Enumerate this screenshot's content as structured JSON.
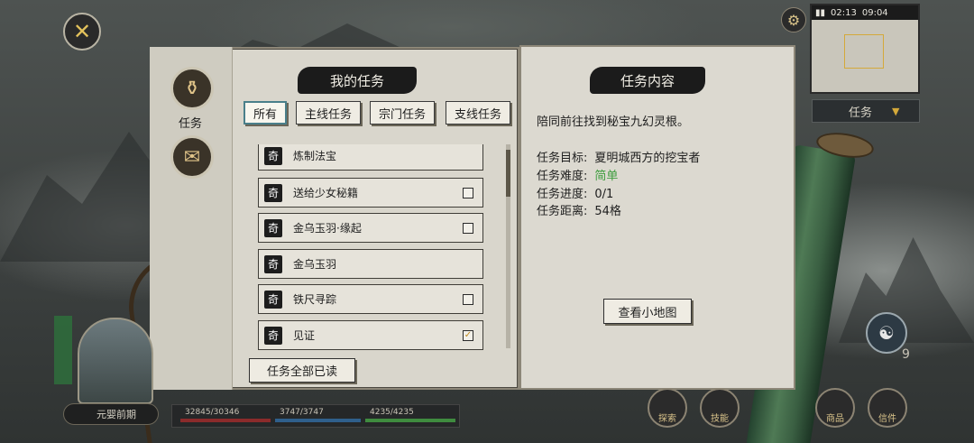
{
  "left_panel": {
    "title": "我的任务",
    "side_label": "任务",
    "tabs": [
      {
        "label": "所有",
        "active": true
      },
      {
        "label": "主线任务",
        "active": false
      },
      {
        "label": "宗门任务",
        "active": false
      },
      {
        "label": "支线任务",
        "active": false
      }
    ],
    "quests": [
      {
        "badge": "奇",
        "name": "炼制法宝",
        "checkbox": "none"
      },
      {
        "badge": "奇",
        "name": "送给少女秘籍",
        "checkbox": "empty"
      },
      {
        "badge": "奇",
        "name": "金乌玉羽·缘起",
        "checkbox": "empty"
      },
      {
        "badge": "奇",
        "name": "金乌玉羽",
        "checkbox": "none"
      },
      {
        "badge": "奇",
        "name": "铁尺寻踪",
        "checkbox": "empty"
      },
      {
        "badge": "奇",
        "name": "见证",
        "checkbox": "checked"
      }
    ],
    "read_all_label": "任务全部已读",
    "scroll_position": 0.05
  },
  "right_panel": {
    "title": "任务内容",
    "description": "陪同前往找到秘宝九幻灵根。",
    "fields": [
      {
        "label": "任务目标:",
        "value": "夏明城西方的挖宝者",
        "color": ""
      },
      {
        "label": "任务难度:",
        "value": "简单",
        "color": "#3f9d3f"
      },
      {
        "label": "任务进度:",
        "value": "0/1",
        "color": ""
      },
      {
        "label": "任务距离:",
        "value": "54格",
        "color": ""
      }
    ],
    "view_map_label": "查看小地图"
  },
  "hud": {
    "time": "02:13",
    "time_suffix": "09:04",
    "task_dropdown_label": "任务",
    "character_name": "元婴前期",
    "hp": "32845/30346",
    "mp": "3747/3747",
    "exp": "4235/4235",
    "level_badge": "9",
    "bottom_menu": [
      "探索",
      "技能",
      "商品",
      "信件"
    ]
  },
  "colors": {
    "accent_teal": "#4a7f8a",
    "difficulty_easy": "#3f9d3f",
    "gold": "#d4a93a"
  }
}
